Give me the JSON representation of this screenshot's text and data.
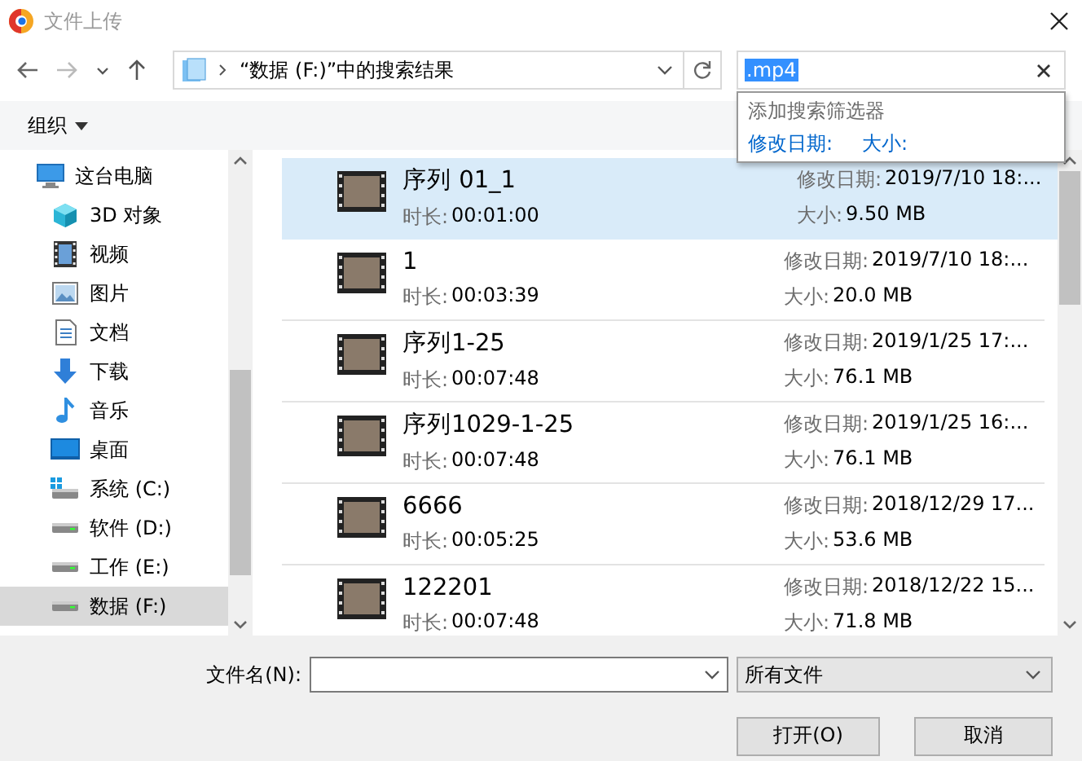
{
  "window": {
    "title": "文件上传"
  },
  "nav": {
    "path": "“数据 (F:)”中的搜索结果",
    "search_value": ".mp4"
  },
  "search_popup": {
    "heading": "添加搜索筛选器",
    "filters": [
      "修改日期:",
      "大小:"
    ]
  },
  "toolbar": {
    "organize": "组织"
  },
  "sidebar": {
    "items": [
      {
        "label": "这台电脑",
        "kind": "pc",
        "selected": false,
        "children": [
          {
            "label": "3D 对象",
            "kind": "cube",
            "selected": false
          },
          {
            "label": "视频",
            "kind": "video",
            "selected": false
          },
          {
            "label": "图片",
            "kind": "picture",
            "selected": false
          },
          {
            "label": "文档",
            "kind": "document",
            "selected": false
          },
          {
            "label": "下载",
            "kind": "download",
            "selected": false
          },
          {
            "label": "音乐",
            "kind": "music",
            "selected": false
          },
          {
            "label": "桌面",
            "kind": "desktop",
            "selected": false
          },
          {
            "label": "系统 (C:)",
            "kind": "system-drive",
            "selected": false
          },
          {
            "label": "软件 (D:)",
            "kind": "drive",
            "selected": false
          },
          {
            "label": "工作 (E:)",
            "kind": "drive",
            "selected": false
          },
          {
            "label": "数据 (F:)",
            "kind": "drive",
            "selected": true
          }
        ]
      }
    ]
  },
  "files": [
    {
      "name": "序列 01_1",
      "duration_label": "时长:",
      "duration": "00:01:00",
      "date_label": "修改日期:",
      "date": "2019/7/10 18:...",
      "size_label": "大小:",
      "size": "9.50 MB",
      "selected": true
    },
    {
      "name": "1",
      "duration_label": "时长:",
      "duration": "00:03:39",
      "date_label": "修改日期:",
      "date": "2019/7/10 18:...",
      "size_label": "大小:",
      "size": "20.0 MB",
      "selected": false
    },
    {
      "name": "序列1-25",
      "duration_label": "时长:",
      "duration": "00:07:48",
      "date_label": "修改日期:",
      "date": "2019/1/25 17:...",
      "size_label": "大小:",
      "size": "76.1 MB",
      "selected": false
    },
    {
      "name": "序列1029-1-25",
      "duration_label": "时长:",
      "duration": "00:07:48",
      "date_label": "修改日期:",
      "date": "2019/1/25 16:...",
      "size_label": "大小:",
      "size": "76.1 MB",
      "selected": false
    },
    {
      "name": "6666",
      "duration_label": "时长:",
      "duration": "00:05:25",
      "date_label": "修改日期:",
      "date": "2018/12/29 17...",
      "size_label": "大小:",
      "size": "53.6 MB",
      "selected": false
    },
    {
      "name": "122201",
      "duration_label": "时长:",
      "duration": "00:07:48",
      "date_label": "修改日期:",
      "date": "2018/12/22 15...",
      "size_label": "大小:",
      "size": "71.8 MB",
      "selected": false
    }
  ],
  "footer": {
    "filename_label": "文件名(N):",
    "file_type": "所有文件",
    "buttons": [
      "打开(O)",
      "取消"
    ]
  }
}
